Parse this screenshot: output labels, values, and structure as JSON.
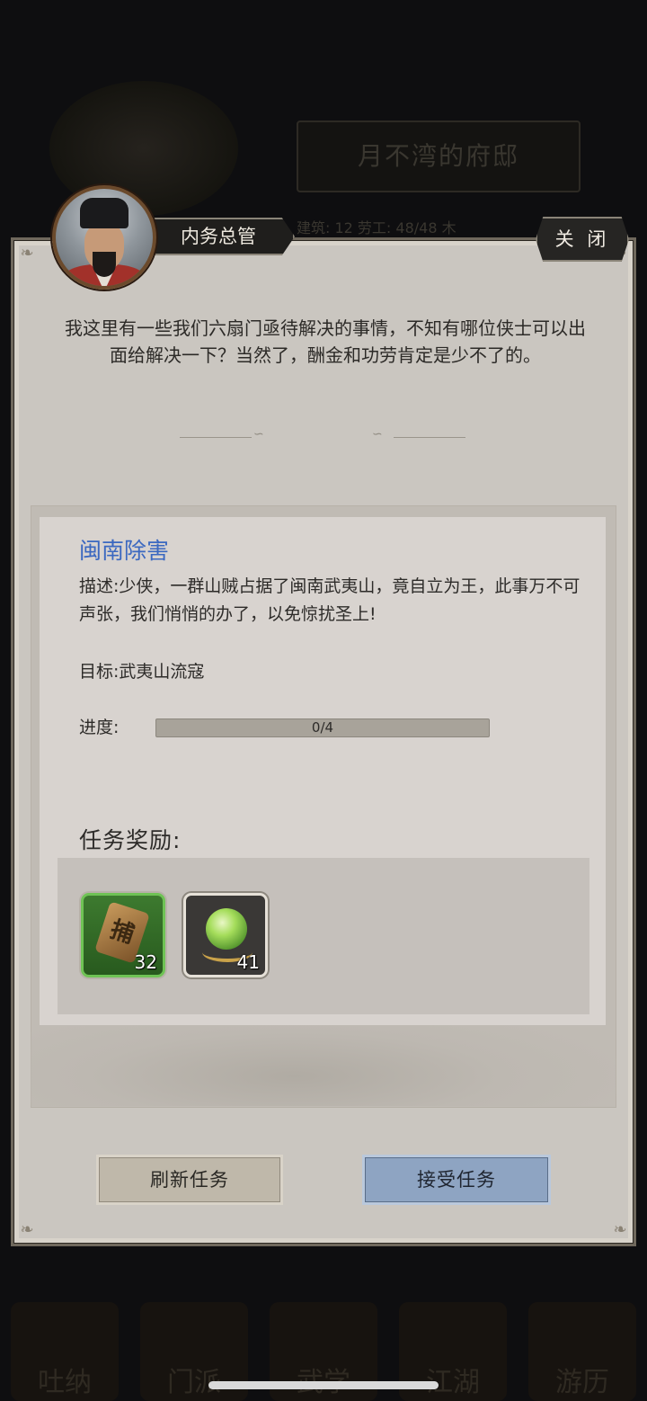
{
  "background": {
    "residence_title": "月不湾的府邸",
    "stats_text": "建筑: 12   劳工: 48/48   木",
    "nav_items": [
      "吐纳",
      "门派",
      "武学",
      "江湖",
      "游历"
    ]
  },
  "npc": {
    "name": "内务总管",
    "dialog": "我这里有一些我们六扇门亟待解决的事情，不知有哪位侠士可以出面给解决一下？当然了，酬金和功劳肯定是少不了的。"
  },
  "close_label": "关 闭",
  "quest": {
    "title": "闽南除害",
    "description": "描述:少侠，一群山贼占据了闽南武夷山，竟自立为王，此事万不可声张，我们悄悄的办了，以免惊扰圣上!",
    "target": "目标:武夷山流寇",
    "progress_label": "进度:",
    "progress_text": "0/4",
    "progress_value": 0,
    "progress_max": 4
  },
  "rewards": {
    "title": "任务奖励:",
    "items": [
      {
        "icon": "bronze-token-icon",
        "glyph": "捕",
        "count": "32"
      },
      {
        "icon": "green-orb-icon",
        "count": "41"
      }
    ]
  },
  "buttons": {
    "refresh": "刷新任务",
    "accept": "接受任务"
  },
  "colors": {
    "quest_title": "#3b68c0",
    "accept_button": "#8ea4c2",
    "refresh_button": "#bfb8aa",
    "reward_rare_border": "#6fc355"
  }
}
